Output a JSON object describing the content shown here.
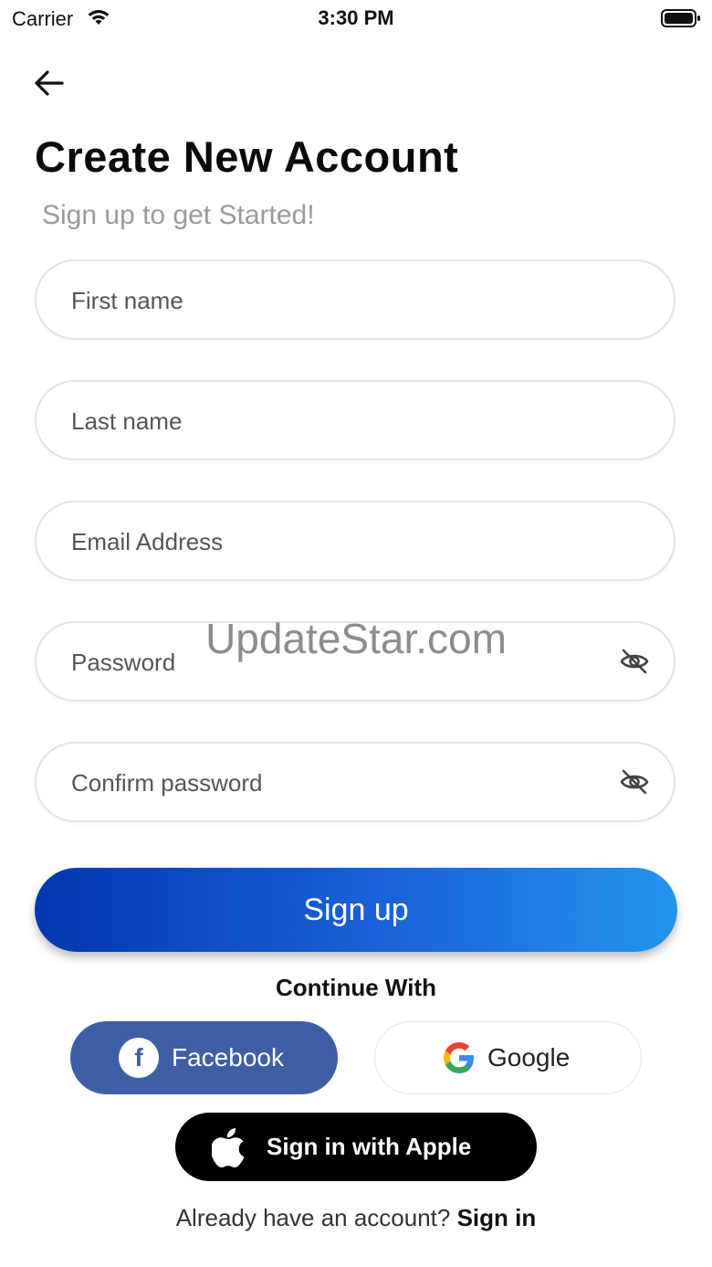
{
  "status_bar": {
    "carrier": "Carrier",
    "time": "3:30 PM"
  },
  "header": {
    "title": "Create New Account",
    "subtitle": "Sign up to get Started!"
  },
  "form": {
    "first_name": {
      "placeholder": "First name",
      "value": ""
    },
    "last_name": {
      "placeholder": "Last name",
      "value": ""
    },
    "email": {
      "placeholder": "Email Address",
      "value": ""
    },
    "password": {
      "placeholder": "Password",
      "value": ""
    },
    "confirm_password": {
      "placeholder": "Confirm password",
      "value": ""
    }
  },
  "watermark": "UpdateStar.com",
  "signup_label": "Sign up",
  "continue_with": "Continue With",
  "social": {
    "facebook_label": "Facebook",
    "google_label": "Google",
    "apple_label": "Sign in with Apple"
  },
  "footer": {
    "prompt": "Already have an account? ",
    "link": "Sign in"
  },
  "colors": {
    "signup_gradient_start": "#0437b0",
    "signup_gradient_end": "#2295ee",
    "facebook": "#3e5fa3",
    "apple": "#000000"
  },
  "icons": [
    "wifi-icon",
    "battery-icon",
    "back-arrow-icon",
    "eye-off-icon",
    "facebook-icon",
    "google-icon",
    "apple-icon"
  ]
}
